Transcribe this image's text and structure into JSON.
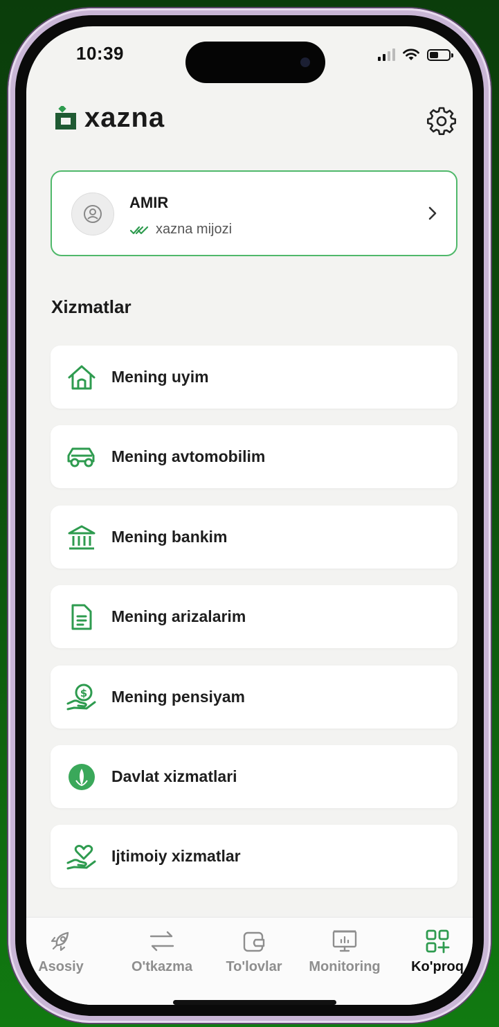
{
  "status_bar": {
    "time": "10:39"
  },
  "header": {
    "brand": "xazna"
  },
  "profile": {
    "name": "AMIR",
    "status": "xazna mijozi"
  },
  "services_section": {
    "title": "Xizmatlar",
    "items": [
      {
        "label": "Mening uyim",
        "icon": "house-icon"
      },
      {
        "label": "Mening avtomobilim",
        "icon": "car-icon"
      },
      {
        "label": "Mening bankim",
        "icon": "bank-icon"
      },
      {
        "label": "Mening arizalarim",
        "icon": "document-icon"
      },
      {
        "label": "Mening pensiyam",
        "icon": "money-hand-icon"
      },
      {
        "label": "Davlat xizmatlari",
        "icon": "government-emblem-icon"
      },
      {
        "label": "Ijtimoiy xizmatlar",
        "icon": "heart-hand-icon"
      }
    ]
  },
  "tabbar": {
    "items": [
      {
        "label": "Asosiy",
        "icon": "rocket-icon",
        "active": false
      },
      {
        "label": "O'tkazma",
        "icon": "transfer-arrows-icon",
        "active": false
      },
      {
        "label": "To'lovlar",
        "icon": "wallet-icon",
        "active": false
      },
      {
        "label": "Monitoring",
        "icon": "monitor-chart-icon",
        "active": false
      },
      {
        "label": "Ko'proq",
        "icon": "grid-plus-icon",
        "active": true
      }
    ]
  },
  "colors": {
    "accent": "#2e9b4f",
    "accent_dark": "#1f5a33",
    "card_border": "#4fb86a"
  }
}
